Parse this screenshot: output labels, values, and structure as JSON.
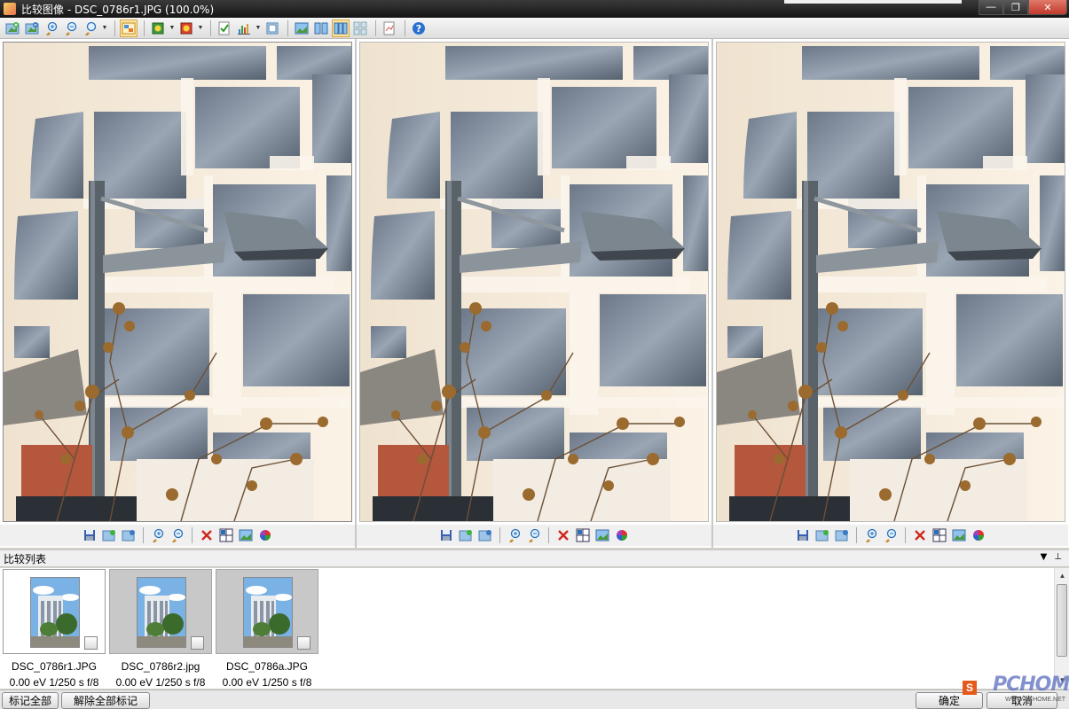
{
  "window": {
    "title": "比较图像 - DSC_0786r1.JPG (100.0%)",
    "buttons": {
      "minimize": "—",
      "restore": "❐",
      "close": "✕"
    }
  },
  "toolbar": {
    "icons": [
      "add-image-icon",
      "remove-image-icon",
      "zoom-in-icon",
      "zoom-out-icon",
      "zoom-options-icon",
      "sync-view-icon",
      "color-adjust-icon",
      "color-options-icon",
      "check-icon",
      "histogram-icon",
      "fit-window-icon",
      "single-view-icon",
      "two-view-icon",
      "three-view-icon",
      "grid-view-icon",
      "export-icon",
      "help-icon"
    ]
  },
  "panes": [
    {
      "name": "pane-1",
      "file": "DSC_0786r1.JPG",
      "selected": true
    },
    {
      "name": "pane-2",
      "file": "DSC_0786r2.jpg",
      "selected": false
    },
    {
      "name": "pane-3",
      "file": "DSC_0786a.JPG",
      "selected": false
    }
  ],
  "pane_toolbar": {
    "icons": [
      "save-icon",
      "add-icon",
      "remove-icon",
      "zoom-in-icon",
      "zoom-out-icon",
      "delete-icon",
      "grid-icon",
      "image-info-icon",
      "color-wheel-icon"
    ]
  },
  "list": {
    "title": "比较列表",
    "dropdown": "▼",
    "pin": "⊥",
    "items": [
      {
        "name": "DSC_0786r1.JPG",
        "info": "0.00 eV 1/250 s f/8",
        "selected": true
      },
      {
        "name": "DSC_0786r2.jpg",
        "info": "0.00 eV 1/250 s f/8",
        "selected": false
      },
      {
        "name": "DSC_0786a.JPG",
        "info": "0.00 eV 1/250 s f/8",
        "selected": false
      }
    ]
  },
  "scrollbar": {
    "up": "▲",
    "down": "▼"
  },
  "bottom": {
    "mark_all": "标记全部",
    "unmark_all": "解除全部标记",
    "ok": "确定",
    "cancel": "取消"
  },
  "watermark": {
    "s": "S",
    "logo": "PCHOME",
    "sub": "WWW.PCHOME.NET"
  }
}
